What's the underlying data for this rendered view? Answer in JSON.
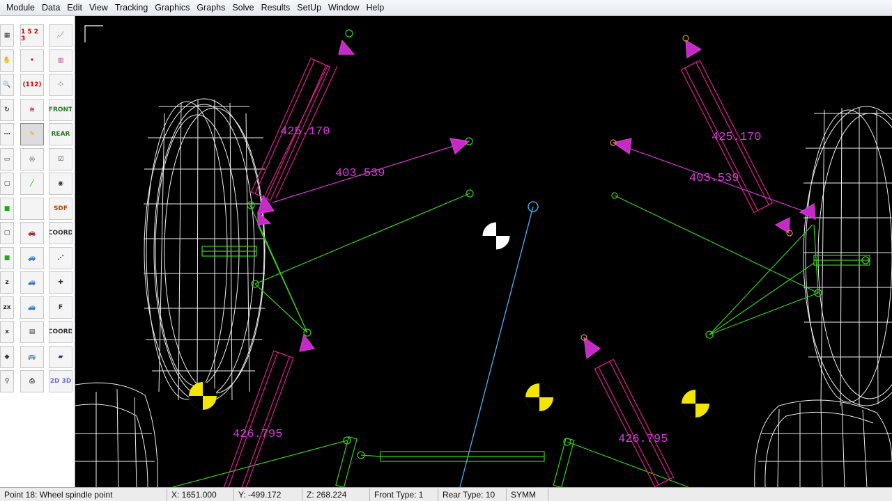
{
  "menu": [
    "Module",
    "Data",
    "Edit",
    "View",
    "Tracking",
    "Graphics",
    "Graphs",
    "Solve",
    "Results",
    "SetUp",
    "Window",
    "Help"
  ],
  "toolbar": {
    "left_column": [
      {
        "name": "partial-icon",
        "glyph": "▦"
      },
      {
        "name": "hand-icon",
        "glyph": "✋"
      },
      {
        "name": "zoom-icon",
        "glyph": "🔍"
      },
      {
        "name": "rotate-icon",
        "glyph": "↻"
      },
      {
        "name": "dots-icon",
        "glyph": "⋯"
      },
      {
        "name": "panel-icon",
        "glyph": "▭"
      },
      {
        "name": "cube-outline-icon",
        "glyph": "▢"
      },
      {
        "name": "cube-green-icon",
        "glyph": "■"
      },
      {
        "name": "cube-icon",
        "glyph": "▢"
      },
      {
        "name": "cube-green-2-icon",
        "glyph": "■"
      },
      {
        "name": "z-axis-icon",
        "glyph": "z"
      },
      {
        "name": "zx-axis-icon",
        "glyph": "zx"
      },
      {
        "name": "x-axis-icon",
        "glyph": "x"
      },
      {
        "name": "view-icon",
        "glyph": "◆"
      },
      {
        "name": "wrench-icon",
        "glyph": "⚲"
      }
    ],
    "middle_column": [
      {
        "name": "numbers-icon",
        "glyph": "1 5 2 3"
      },
      {
        "name": "point-icon",
        "glyph": "•"
      },
      {
        "name": "coords-icon",
        "glyph": "(112)"
      },
      {
        "name": "spring-icon",
        "glyph": "≋"
      },
      {
        "name": "pencil-icon",
        "glyph": "✎"
      },
      {
        "name": "wheel-icon",
        "glyph": "◎"
      },
      {
        "name": "link-icon",
        "glyph": "╱"
      },
      {
        "name": "blank-icon",
        "glyph": ""
      },
      {
        "name": "car-red-icon",
        "glyph": "🚗"
      },
      {
        "name": "car-icon",
        "glyph": "🚙"
      },
      {
        "name": "car-2-icon",
        "glyph": "🚙"
      },
      {
        "name": "car-3-icon",
        "glyph": "🚙"
      },
      {
        "name": "film-icon",
        "glyph": "▤"
      },
      {
        "name": "vehicle-front-icon",
        "glyph": "🚌"
      },
      {
        "name": "print-icon",
        "glyph": "⎙"
      }
    ],
    "right_column": [
      {
        "name": "graph-icon",
        "glyph": "📈"
      },
      {
        "name": "chart-icon",
        "glyph": "▥"
      },
      {
        "name": "scatter-icon",
        "glyph": "⁘"
      },
      {
        "name": "front-icon",
        "glyph": "FRONT"
      },
      {
        "name": "rear-icon",
        "glyph": "REAR"
      },
      {
        "name": "checklist-icon",
        "glyph": "☑"
      },
      {
        "name": "tire-icon",
        "glyph": "◉"
      },
      {
        "name": "sdf-icon",
        "glyph": "SDF"
      },
      {
        "name": "coord-icon",
        "glyph": "COORD"
      },
      {
        "name": "diagonal-icon",
        "glyph": "⋰"
      },
      {
        "name": "plus-points-icon",
        "glyph": "✚"
      },
      {
        "name": "f-icon",
        "glyph": "F"
      },
      {
        "name": "coord-file-icon",
        "glyph": "COORD"
      },
      {
        "name": "layers-icon",
        "glyph": "▰"
      },
      {
        "name": "2d-3d-icon",
        "glyph": "2D 3D"
      }
    ]
  },
  "viewport": {
    "dimensions": [
      "425.170",
      "403.539",
      "425.170",
      "403.539",
      "426.795",
      "426.795"
    ]
  },
  "status": {
    "point": "Point 18: Wheel spindle point",
    "x": "X: 1651.000",
    "y": "Y: -499.172",
    "z": "Z: 268.224",
    "front_type": "Front Type: 1",
    "rear_type": "Rear Type: 10",
    "symm": "SYMM"
  },
  "colors": {
    "background": "#000000",
    "wireframe": "#ffffff",
    "spring": "#e0208c",
    "link_green": "#39d11a",
    "arrow_magenta": "#d93ad9",
    "axis_blue": "#4aa6e8",
    "cg_yellow": "#f2e600"
  }
}
